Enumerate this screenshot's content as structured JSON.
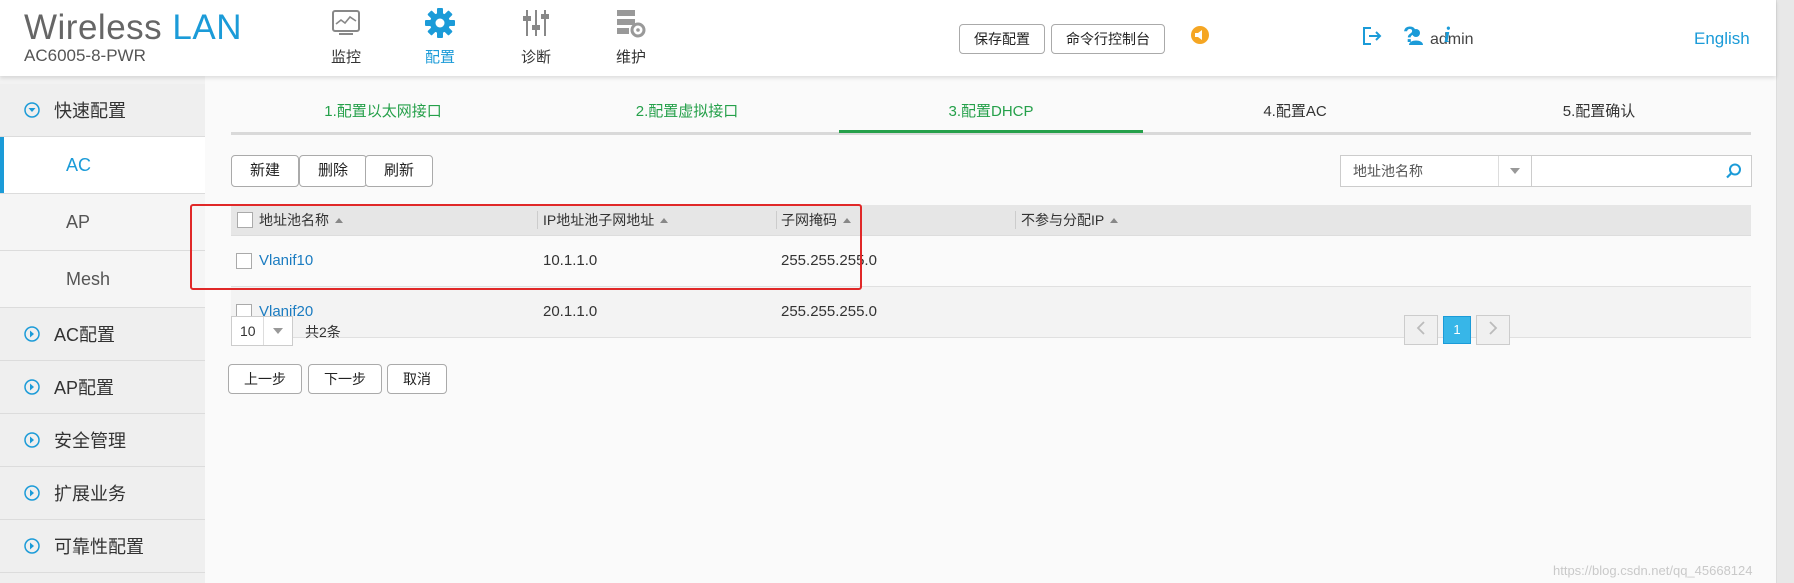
{
  "brand": {
    "title_part1": "Wireless",
    "title_part2": "LAN",
    "model": "AC6005-8-PWR"
  },
  "nav": [
    {
      "label": "监控",
      "icon": "monitor-icon"
    },
    {
      "label": "配置",
      "icon": "gear-icon",
      "active": true
    },
    {
      "label": "诊断",
      "icon": "sliders-icon"
    },
    {
      "label": "维护",
      "icon": "maintenance-icon"
    }
  ],
  "header": {
    "save_config": "保存配置",
    "cli_console": "命令行控制台",
    "username": "admin",
    "language": "English"
  },
  "sidebar": {
    "quick_config": "快速配置",
    "sub_items": [
      "AC",
      "AP",
      "Mesh"
    ],
    "items": [
      "AC配置",
      "AP配置",
      "安全管理",
      "扩展业务",
      "可靠性配置"
    ]
  },
  "steps": [
    {
      "label": "1.配置以太网接口",
      "state": "done"
    },
    {
      "label": "2.配置虚拟接口",
      "state": "done"
    },
    {
      "label": "3.配置DHCP",
      "state": "current"
    },
    {
      "label": "4.配置AC",
      "state": "todo"
    },
    {
      "label": "5.配置确认",
      "state": "todo"
    }
  ],
  "toolbar": {
    "new": "新建",
    "delete": "删除",
    "refresh": "刷新"
  },
  "search": {
    "field": "地址池名称",
    "value": ""
  },
  "table": {
    "columns": [
      "地址池名称",
      "IP地址池子网地址",
      "子网掩码",
      "不参与分配IP"
    ],
    "rows": [
      {
        "name": "Vlanif10",
        "subnet": "10.1.1.0",
        "mask": "255.255.255.0",
        "excluded": ""
      },
      {
        "name": "Vlanif20",
        "subnet": "20.1.1.0",
        "mask": "255.255.255.0",
        "excluded": ""
      }
    ]
  },
  "pagination": {
    "page_size": "10",
    "total": "共2条",
    "current_page": "1"
  },
  "footer": {
    "prev": "上一步",
    "next": "下一步",
    "cancel": "取消"
  },
  "watermark": "https://blog.csdn.net/qq_45668124",
  "colors": {
    "accent": "#1b9bd8",
    "step_done": "#25a04a",
    "highlight": "#e02828"
  }
}
